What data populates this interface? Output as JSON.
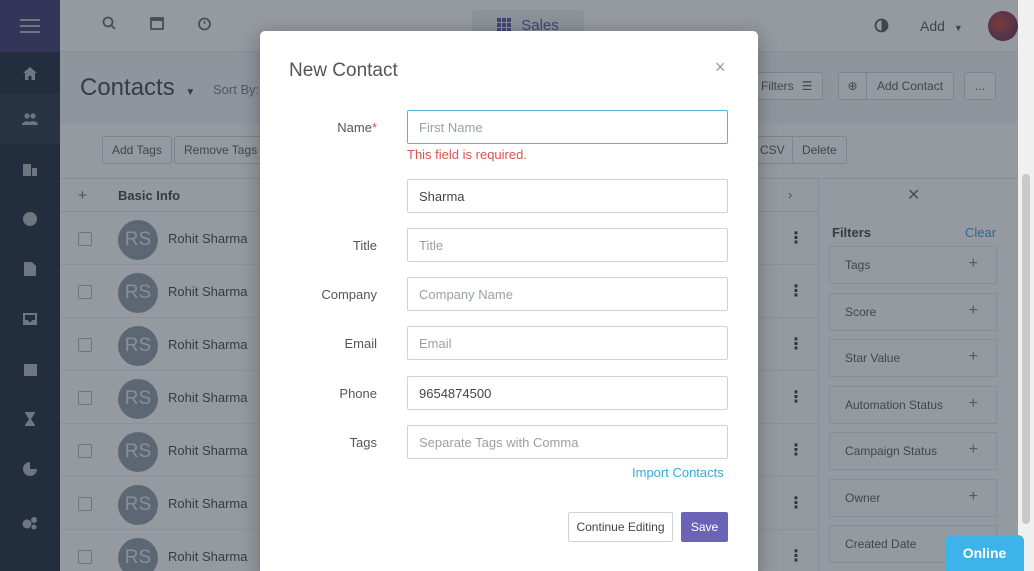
{
  "topbar": {
    "app_switcher_label": "Sales",
    "add_label": "Add"
  },
  "subheader": {
    "page_title": "Contacts",
    "sort_by_label": "Sort By:",
    "filters_label": "Filters",
    "add_contact_label": "Add Contact",
    "more_label": "..."
  },
  "actionbar": {
    "add_tags_label": "Add Tags",
    "remove_tags_label": "Remove Tags",
    "csv_label": "CSV",
    "delete_label": "Delete"
  },
  "table": {
    "add_col_label": "+",
    "basic_info_header": "Basic Info",
    "rows": [
      {
        "initials": "RS",
        "name": "Rohit Sharma"
      },
      {
        "initials": "RS",
        "name": "Rohit Sharma"
      },
      {
        "initials": "RS",
        "name": "Rohit Sharma"
      },
      {
        "initials": "RS",
        "name": "Rohit Sharma"
      },
      {
        "initials": "RS",
        "name": "Rohit Sharma"
      },
      {
        "initials": "RS",
        "name": "Rohit Sharma"
      },
      {
        "initials": "RS",
        "name": "Rohit Sharma"
      }
    ]
  },
  "filters": {
    "title": "Filters",
    "clear_label": "Clear",
    "items": [
      {
        "label": "Tags"
      },
      {
        "label": "Score"
      },
      {
        "label": "Star Value"
      },
      {
        "label": "Automation Status"
      },
      {
        "label": "Campaign Status"
      },
      {
        "label": "Owner"
      },
      {
        "label": "Created Date"
      }
    ]
  },
  "modal": {
    "title": "New Contact",
    "close_label": "×",
    "name_label": "Name",
    "required_mark": "*",
    "first_name_placeholder": "First Name",
    "first_name_value": "",
    "name_error": "This field is required.",
    "last_name_value": "Sharma",
    "title_label": "Title",
    "title_placeholder": "Title",
    "company_label": "Company",
    "company_placeholder": "Company Name",
    "email_label": "Email",
    "email_placeholder": "Email",
    "phone_label": "Phone",
    "phone_value": "9654874500",
    "tags_label": "Tags",
    "tags_placeholder": "Separate Tags with Comma",
    "import_contacts_label": "Import Contacts",
    "continue_editing_label": "Continue Editing",
    "save_label": "Save"
  },
  "online_badge": "Online",
  "colors": {
    "accent": "#6a63b6",
    "link": "#3ba8d8",
    "error": "#d9534f",
    "online": "#3eb3ea",
    "sidebar": "#2f3a4c"
  }
}
